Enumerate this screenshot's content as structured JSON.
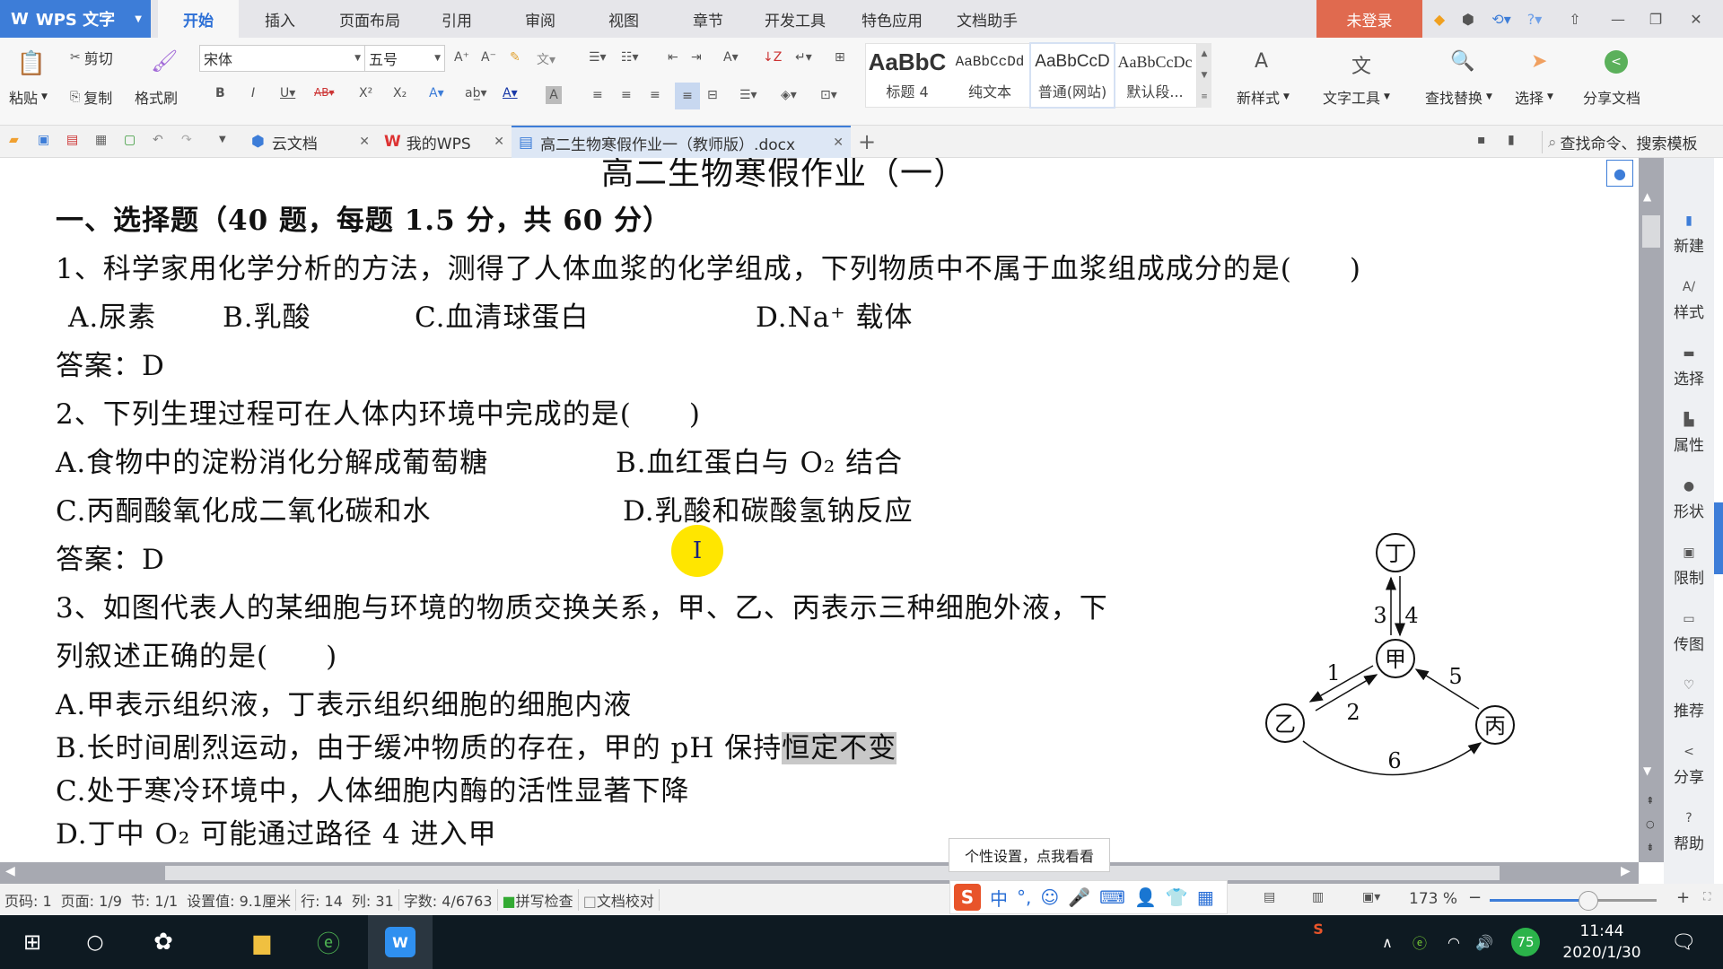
{
  "app": {
    "name": "WPS 文字",
    "login": "未登录"
  },
  "menu_tabs": [
    "开始",
    "插入",
    "页面布局",
    "引用",
    "审阅",
    "视图",
    "章节",
    "开发工具",
    "特色应用",
    "文档助手"
  ],
  "active_menu_tab": "开始",
  "ribbon": {
    "paste": "粘贴",
    "cut": "剪切",
    "copy": "复制",
    "format_painter": "格式刷",
    "font_name": "宋体",
    "font_size": "五号",
    "styles": [
      {
        "preview": "AaBbC",
        "label": "标题 4"
      },
      {
        "preview": "AaBbCcDd",
        "label": "纯文本"
      },
      {
        "preview": "AaBbCcD",
        "label": "普通(网站)"
      },
      {
        "preview": "AaBbCcDc",
        "label": "默认段..."
      }
    ],
    "new_style": "新样式",
    "text_tools": "文字工具",
    "find_replace": "查找替换",
    "select": "选择",
    "share_doc": "分享文档"
  },
  "tabs": [
    {
      "label": "云文档",
      "icon": "cloud-icon"
    },
    {
      "label": "我的WPS",
      "icon": "wps-logo-icon"
    },
    {
      "label": "高二生物寒假作业一（教师版）.docx",
      "icon": "doc-icon",
      "active": true
    }
  ],
  "search_placeholder": "查找命令、搜索模板",
  "document": {
    "title": "高二生物寒假作业（一）",
    "section": "一、选择题（40 题，每题 1.5 分，共 60 分）",
    "q1": "1、科学家用化学分析的方法，测得了人体血浆的化学组成，下列物质中不属于血浆组成成分的是(　　)",
    "q1_options": [
      "A.尿素",
      "B.乳酸",
      "C.血清球蛋白",
      "D.Na⁺ 载体"
    ],
    "q1_answer": "答案：D",
    "q2": "2、下列生理过程可在人体内环境中完成的是(　　)",
    "q2_options": [
      "A.食物中的淀粉消化分解成葡萄糖",
      "B.血红蛋白与 O₂ 结合",
      "C.丙酮酸氧化成二氧化碳和水",
      "D.乳酸和碳酸氢钠反应"
    ],
    "q2_answer": "答案：D",
    "q3_line1": "3、如图代表人的某细胞与环境的物质交换关系，甲、乙、丙表示三种细胞外液，下",
    "q3_line2": "列叙述正确的是(　　)",
    "q3_A": "A.甲表示组织液，丁表示组织细胞的细胞内液",
    "q3_B_pre": "B.长时间剧烈运动，由于缓冲物质的存在，甲的 pH 保持",
    "q3_B_hl": "恒定不变",
    "q3_C": "C.处于寒冷环境中，人体细胞内酶的活性显著下降",
    "q3_D": "D.丁中 O₂ 可能通过路径 4 进入甲",
    "diagram": {
      "nodes": [
        "丁",
        "甲",
        "乙",
        "丙"
      ],
      "edges": [
        {
          "label": "3",
          "from": "甲",
          "to": "丁"
        },
        {
          "label": "4",
          "from": "丁",
          "to": "甲"
        },
        {
          "label": "1",
          "from": "甲",
          "to": "乙"
        },
        {
          "label": "2",
          "from": "乙",
          "to": "甲"
        },
        {
          "label": "5",
          "from": "丙",
          "to": "甲"
        },
        {
          "label": "6",
          "from": "乙",
          "to": "丙"
        }
      ]
    }
  },
  "side_panel": [
    "新建",
    "样式",
    "选择",
    "属性",
    "形状",
    "限制",
    "传图",
    "推荐",
    "分享",
    "帮助"
  ],
  "status": {
    "page_code": "页码: 1",
    "page": "页面: 1/9",
    "section": "节: 1/1",
    "setting": "设置值: 9.1厘米",
    "row": "行: 14",
    "col": "列: 31",
    "words": "字数: 4/6763",
    "spell": "拼写检查",
    "proof": "文档校对",
    "zoom": "173 %",
    "zoom_percent": 173
  },
  "ime": {
    "tooltip": "个性设置，点我看看",
    "mode": "中"
  },
  "taskbar": {
    "time": "11:44",
    "date": "2020/1/30",
    "battery_badge": "75"
  }
}
